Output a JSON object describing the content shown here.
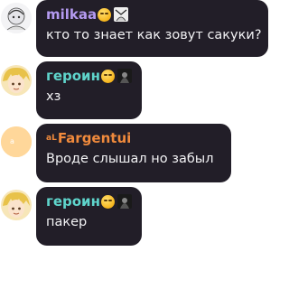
{
  "colors": {
    "bubble_bg": "#221e28",
    "message_text": "#f2f2f4",
    "name_milkaa": "#b49af0",
    "name_geroin": "#5fd5cc",
    "name_fargentui": "#f08a3c"
  },
  "messages": [
    {
      "author": "milkaa",
      "author_icon": "smirk-emoji",
      "text": "кто то знает как зовут сакуки?"
    },
    {
      "author": "героин",
      "author_icon": "smirk-emoji",
      "text": "хз"
    },
    {
      "author_prefix": "aL",
      "author": "Fargentui",
      "text": "Вроде слышал но забыл"
    },
    {
      "author": "героин",
      "author_icon": "smirk-emoji",
      "text": "пакер"
    }
  ]
}
